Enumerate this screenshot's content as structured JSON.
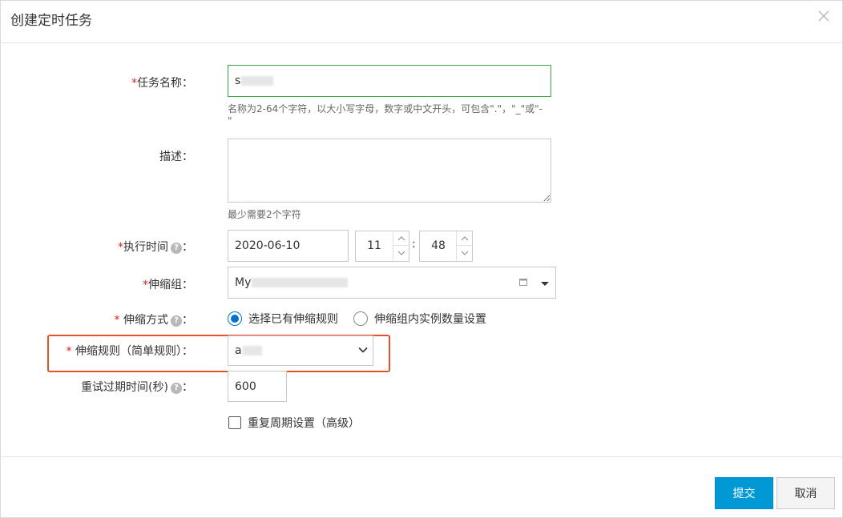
{
  "dialog": {
    "title": "创建定时任务",
    "close_icon": "close-icon"
  },
  "form": {
    "task_name": {
      "required": "*",
      "label": "任务名称：",
      "value": "s",
      "hint_line1": "名称为2-64个字符，以大小写字母，数字或中文开头，可包含\".\"，\"_\"或\"-",
      "hint_line2": "\""
    },
    "description": {
      "label": "描述：",
      "value": "",
      "hint": "最少需要2个字符"
    },
    "exec_time": {
      "required": "*",
      "label": "执行时间",
      "colon": "：",
      "help": "?",
      "date": "2020-06-10",
      "hour": "11",
      "time_sep": ":",
      "minute": "48"
    },
    "scaling_group": {
      "required": "*",
      "label": "伸缩组：",
      "value": "My"
    },
    "scaling_method": {
      "required": "*",
      "label": "伸缩方式",
      "colon": "：",
      "help": "?",
      "options": [
        "选择已有伸缩规则",
        "伸缩组内实例数量设置"
      ],
      "selected": 0
    },
    "scaling_rule": {
      "required": "*",
      "label": "伸缩规则（简单规则）：",
      "value": "a"
    },
    "retry_timeout": {
      "label": "重试过期时间(秒)",
      "colon": "：",
      "help": "?",
      "value": "600"
    },
    "repeat": {
      "label": "重复周期设置（高级）",
      "checked": false
    }
  },
  "footer": {
    "submit_label": "提交",
    "cancel_label": "取消"
  },
  "colors": {
    "primary": "#0099d6",
    "required": "#e2231a",
    "highlight": "#e4512b",
    "focus": "#3fa54a",
    "radio": "#0070cc"
  }
}
